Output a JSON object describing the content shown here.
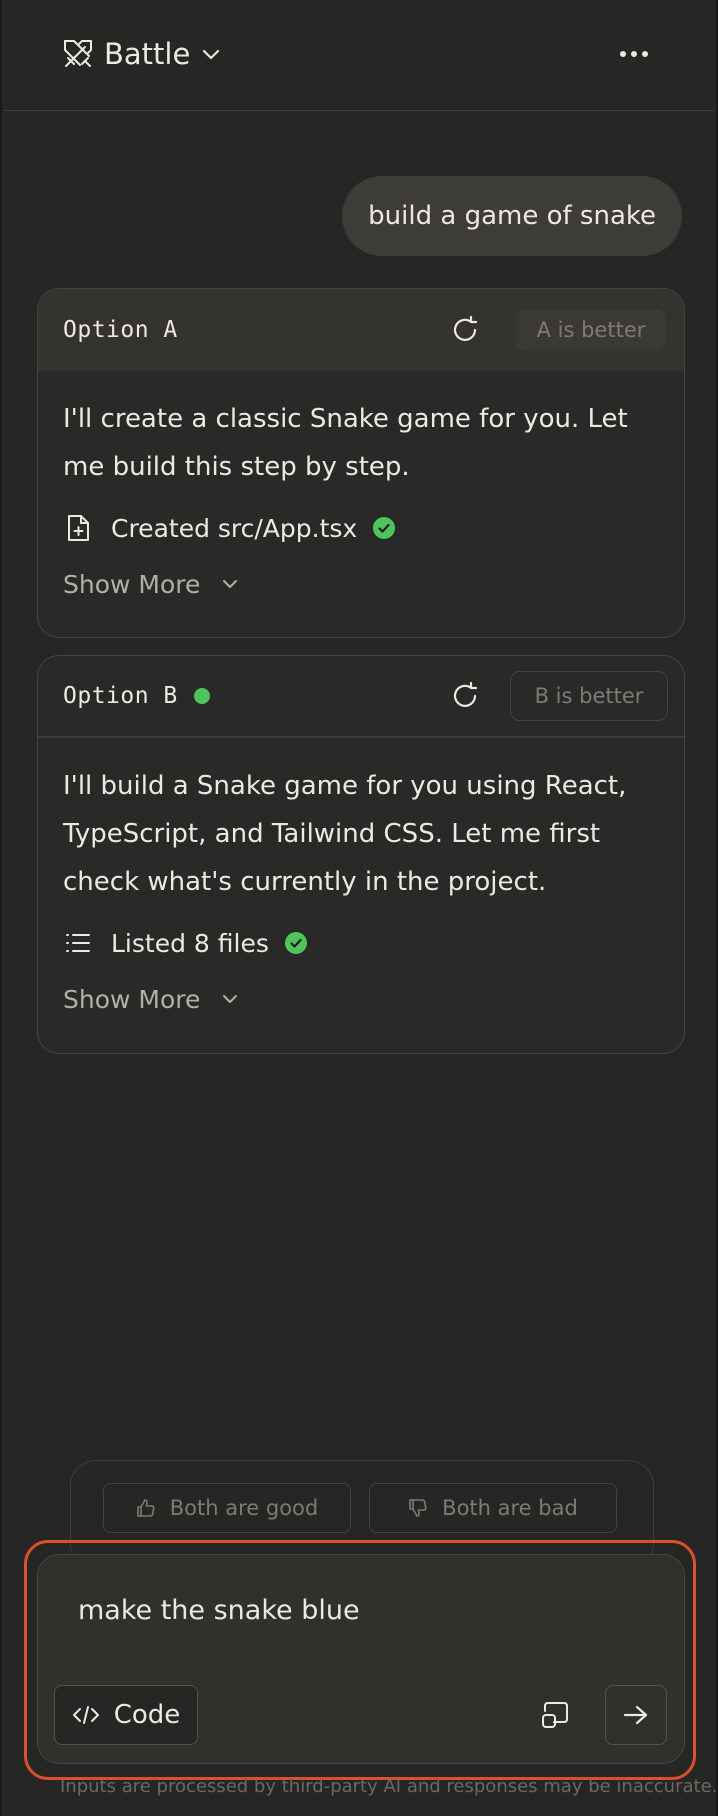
{
  "header": {
    "mode_label": "Battle",
    "icons": {
      "mode": "crossed-swords-icon",
      "dropdown": "chevron-down-icon",
      "more": "more-horizontal-icon"
    }
  },
  "conversation": {
    "user_message": "build a game of snake",
    "option_a": {
      "title": "Option A",
      "better_label": "A is better",
      "text": "I'll create a classic Snake game for you. Let me build this step by step.",
      "tool_text": "Created src/App.tsx",
      "tool_icon": "file-plus-icon",
      "show_more": "Show More"
    },
    "option_b": {
      "title": "Option B",
      "better_label": "B is better",
      "text": "I'll build a Snake game for you using React, TypeScript, and Tailwind CSS. Let me first check what's currently in the project.",
      "tool_text": "Listed 8 files",
      "tool_icon": "list-icon",
      "show_more": "Show More"
    }
  },
  "vote": {
    "both_good": "Both are good",
    "both_bad": "Both are bad"
  },
  "composer": {
    "input_value": "make the snake blue",
    "code_label": "Code",
    "icons": {
      "code": "code-icon",
      "attach": "attach-icon",
      "send": "arrow-right-icon"
    }
  },
  "footer": {
    "disclaimer": "Inputs are processed by third-party AI and responses may be inaccurate."
  },
  "colors": {
    "background": "#262624",
    "accent_outline": "#d9502b",
    "success": "#4fc45c"
  }
}
